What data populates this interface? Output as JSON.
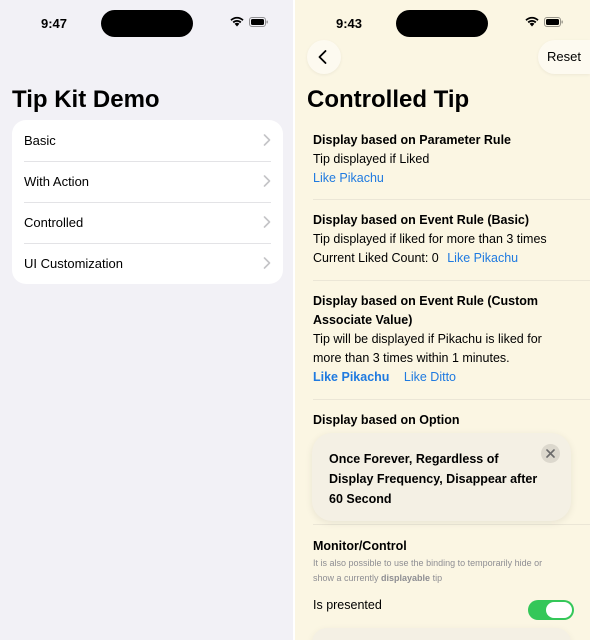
{
  "left_phone": {
    "status_time": "9:47",
    "title": "Tip Kit Demo",
    "items": [
      {
        "label": "Basic"
      },
      {
        "label": "With Action"
      },
      {
        "label": "Controlled"
      },
      {
        "label": "UI Customization"
      }
    ]
  },
  "right_phone": {
    "status_time": "9:43",
    "nav": {
      "back_icon": "chevron-left-icon",
      "reset_label": "Reset"
    },
    "title": "Controlled Tip",
    "sections": {
      "parameter_rule": {
        "heading": "Display based on Parameter Rule",
        "text": "Tip displayed if Liked",
        "link": "Like Pikachu"
      },
      "event_rule_basic": {
        "heading": "Display based on Event Rule (Basic)",
        "text": "Tip displayed if liked for more than 3 times",
        "count_label": "Current Liked Count: 0",
        "link": "Like Pikachu"
      },
      "event_rule_custom": {
        "heading_line1": "Display based on Event Rule (Custom",
        "heading_line2": "Associate Value)",
        "text_line1": "Tip will be displayed if Pikachu is liked for",
        "text_line2": "more than 3 times within 1 minutes.",
        "link1": "Like Pikachu",
        "link2": "Like Ditto"
      },
      "option": {
        "heading": "Display based on Option",
        "tip_line1": "Once Forever, Regardless of",
        "tip_line2": "Display Frequency, Disappear after",
        "tip_line3": "60 Second"
      },
      "monitor": {
        "heading": "Monitor/Control",
        "desc_line1": "It is also possible to use the binding to temporarily hide or",
        "desc_pre": "show a currently ",
        "desc_bold": "displayable",
        "desc_post": " tip",
        "toggle_label": "Is presented",
        "toggle_on": true
      }
    }
  },
  "colors": {
    "link": "#1f7ae0",
    "toggle_on": "#34c759",
    "left_bg": "#f2f1f6",
    "right_bg": "#fbf6e3"
  }
}
